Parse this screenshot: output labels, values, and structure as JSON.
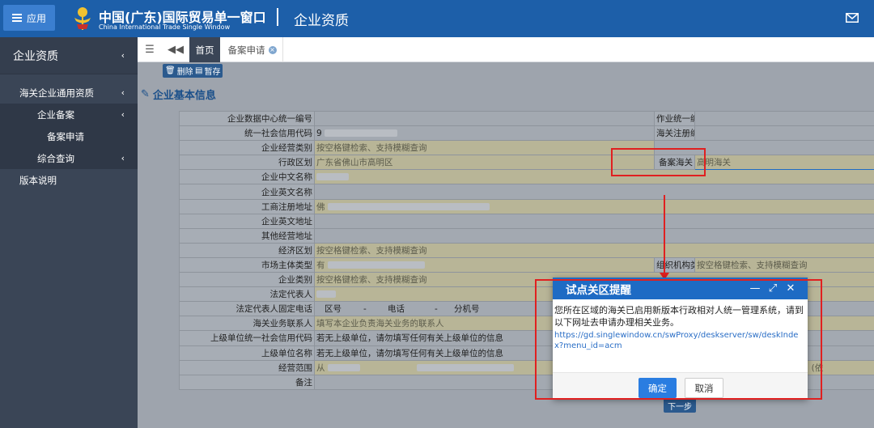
{
  "header": {
    "app_button": "应用",
    "brand_cn": "中国(广东)国际贸易单一窗口",
    "brand_en": "China International Trade Single Window",
    "page_name": "企业资质"
  },
  "sidebar": {
    "title": "企业资质",
    "items": [
      {
        "label": "海关企业通用资质"
      },
      {
        "label": "企业备案"
      },
      {
        "label": "备案申请"
      },
      {
        "label": "综合查询"
      },
      {
        "label": "版本说明"
      }
    ]
  },
  "tabs": {
    "home": "首页",
    "record": "备案申请"
  },
  "toolbar": {
    "delete": "删除",
    "save": "暂存"
  },
  "section_title": "企业基本信息",
  "form": {
    "r1": {
      "l1": "企业数据中心统一编号",
      "v1": "",
      "l2": "作业统一编号",
      "v2": ""
    },
    "r2": {
      "l1": "统一社会信用代码",
      "v1": "9",
      "l2": "海关注册编码",
      "v2": ""
    },
    "r3": {
      "l1": "企业经营类别",
      "v1": "按空格键检索、支持模糊查询"
    },
    "r4": {
      "l1": "行政区划",
      "v1": "广东省佛山市高明区",
      "l2": "备案海关",
      "v2": "高明海关"
    },
    "r5": {
      "l1": "企业中文名称",
      "v1": ""
    },
    "r6": {
      "l1": "企业英文名称",
      "v1": ""
    },
    "r7": {
      "l1": "工商注册地址",
      "v1": "佛"
    },
    "r8": {
      "l1": "企业英文地址",
      "v1": ""
    },
    "r9": {
      "l1": "其他经营地址",
      "v1": ""
    },
    "r10": {
      "l1": "经济区划",
      "v1": "按空格键检索、支持模糊查询"
    },
    "r11": {
      "l1": "市场主体类型",
      "v1": "有",
      "l2": "组织机构类型",
      "v2": "按空格键检索、支持模糊查询"
    },
    "r12": {
      "l1": "企业类别",
      "v1": "按空格键检索、支持模糊查询"
    },
    "r13": {
      "l1": "法定代表人",
      "v1": ""
    },
    "r14": {
      "l1": "法定代表人固定电话",
      "area": "区号",
      "phone": "电话",
      "ext": "分机号"
    },
    "r15": {
      "l1": "海关业务联系人",
      "v1": "填写本企业负责海关业务的联系人"
    },
    "r16": {
      "l1": "上级单位统一社会信用代码",
      "v1": "若无上级单位，请勿填写任何有关上级单位的信息"
    },
    "r17": {
      "l1": "上级单位名称",
      "v1": "若无上级单位，请勿填写任何有关上级单位的信息"
    },
    "r18": {
      "l1": "经营范围",
      "v1": "从",
      "tail": "证件经营）。(依"
    },
    "r19": {
      "l1": "备注",
      "v1": ""
    }
  },
  "next_button": "下一步",
  "dialog": {
    "title": "试点关区提醒",
    "message": "您所在区域的海关已启用新版本行政相对人统一管理系统，请到以下网址去申请办理相关业务。",
    "link": "https://gd.singlewindow.cn/swProxy/deskserver/sw/deskIndex?menu_id=acm",
    "ok": "确定",
    "cancel": "取消"
  },
  "colors": {
    "header_bg": "#1d5fa9",
    "sidebar_bg": "#3a4556",
    "dialog_header": "#1e6bc4",
    "ok_button": "#2a7de1",
    "annotation_red": "#e02020"
  }
}
